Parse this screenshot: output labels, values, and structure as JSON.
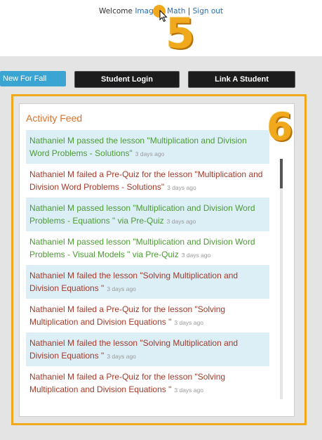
{
  "header": {
    "welcome_prefix": "Welcome ",
    "user_link": "Imagine Math",
    "separator": " | ",
    "signout_label": "Sign out"
  },
  "annotations": {
    "step_a": "5",
    "step_b": "6"
  },
  "nav": {
    "new_for_fall": "New For Fall",
    "student_login": "Student Login",
    "link_student": "Link A Student"
  },
  "activity_feed": {
    "title": "Activity Feed",
    "items": [
      {
        "text": "Nathaniel M passed the lesson \"Multiplication and Division Word Problems - Solutions\"",
        "ago": "3 days ago",
        "status": "pass"
      },
      {
        "text": "Nathaniel M failed a Pre-Quiz for the lesson \"Multiplication and Division Word Problems - Solutions\"",
        "ago": "3 days ago",
        "status": "fail"
      },
      {
        "text": "Nathaniel M passed lesson \"Multiplication and Division Word Problems - Equations \" via Pre-Quiz",
        "ago": "3 days ago",
        "status": "pass"
      },
      {
        "text": "Nathaniel M passed lesson \"Multiplication and Division Word Problems - Visual Models \" via Pre-Quiz",
        "ago": "3 days ago",
        "status": "pass"
      },
      {
        "text": "Nathaniel M failed the lesson \"Solving Multiplication and Division Equations \"",
        "ago": "3 days ago",
        "status": "fail"
      },
      {
        "text": "Nathaniel M failed a Pre-Quiz for the lesson \"Solving Multiplication and Division Equations \"",
        "ago": "3 days ago",
        "status": "fail"
      },
      {
        "text": "Nathaniel M failed the lesson \"Solving Multiplication and Division Equations \"",
        "ago": "3 days ago",
        "status": "fail"
      },
      {
        "text": "Nathaniel M failed a Pre-Quiz for the lesson \"Solving Multiplication and Division Equations \"",
        "ago": "3 days ago",
        "status": "fail"
      }
    ]
  },
  "colors": {
    "accent_orange": "#f0a81c",
    "pass_green": "#4c9b34",
    "fail_red": "#a33a2a",
    "nav_blue": "#3aa5d2",
    "alt_row": "#dceff7"
  }
}
